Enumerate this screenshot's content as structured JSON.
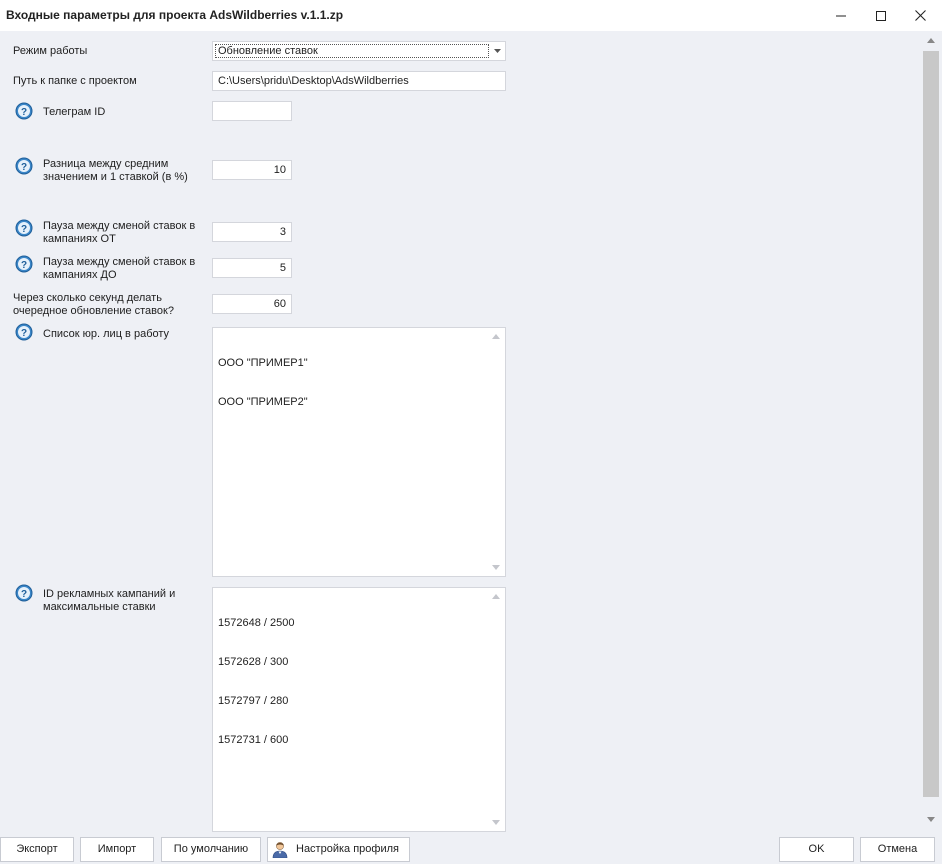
{
  "window": {
    "title": "Входные параметры для проекта AdsWildberries v.1.1.zp",
    "minimize_icon": "minimize-icon",
    "maximize_icon": "maximize-icon",
    "close_icon": "close-icon"
  },
  "form": {
    "mode": {
      "label": "Режим работы",
      "value": "Обновление ставок"
    },
    "project_path": {
      "label": "Путь к папке с проектом",
      "value": "C:\\Users\\pridu\\Desktop\\AdsWildberries"
    },
    "telegram_id": {
      "label": "Телеграм ID",
      "value": ""
    },
    "avg_diff": {
      "label_line1": "Разница между средним",
      "label_line2": "значением и 1 ставкой (в %)",
      "value": "10"
    },
    "pause_from": {
      "label_line1": "Пауза между сменой ставок в",
      "label_line2": "кампаниях ОТ",
      "value": "3"
    },
    "pause_to": {
      "label_line1": "Пауза между сменой ставок в",
      "label_line2": "кампаниях ДО",
      "value": "5"
    },
    "refresh_seconds": {
      "label_line1": "Через сколько секунд делать",
      "label_line2": "очередное обновление ставок?",
      "value": "60"
    },
    "legal_entities": {
      "label": "Список юр. лиц в работу",
      "lines": [
        "ООО \"ПРИМЕР1\"",
        "ООО \"ПРИМЕР2\""
      ]
    },
    "campaigns": {
      "label_line1": "ID рекламных кампаний и",
      "label_line2": "максимальные ставки",
      "lines": [
        "1572648 / 2500",
        "1572628 / 300",
        "1572797 / 280",
        "1572731 / 600"
      ]
    }
  },
  "buttons": {
    "export": "Экспорт",
    "import": "Импорт",
    "defaults": "По умолчанию",
    "profile_settings": "Настройка профиля",
    "ok": "OK",
    "cancel": "Отмена"
  },
  "colors": {
    "background": "#eef0f5",
    "help_icon": "#3a86c8",
    "field_border": "#d4d6dc"
  }
}
